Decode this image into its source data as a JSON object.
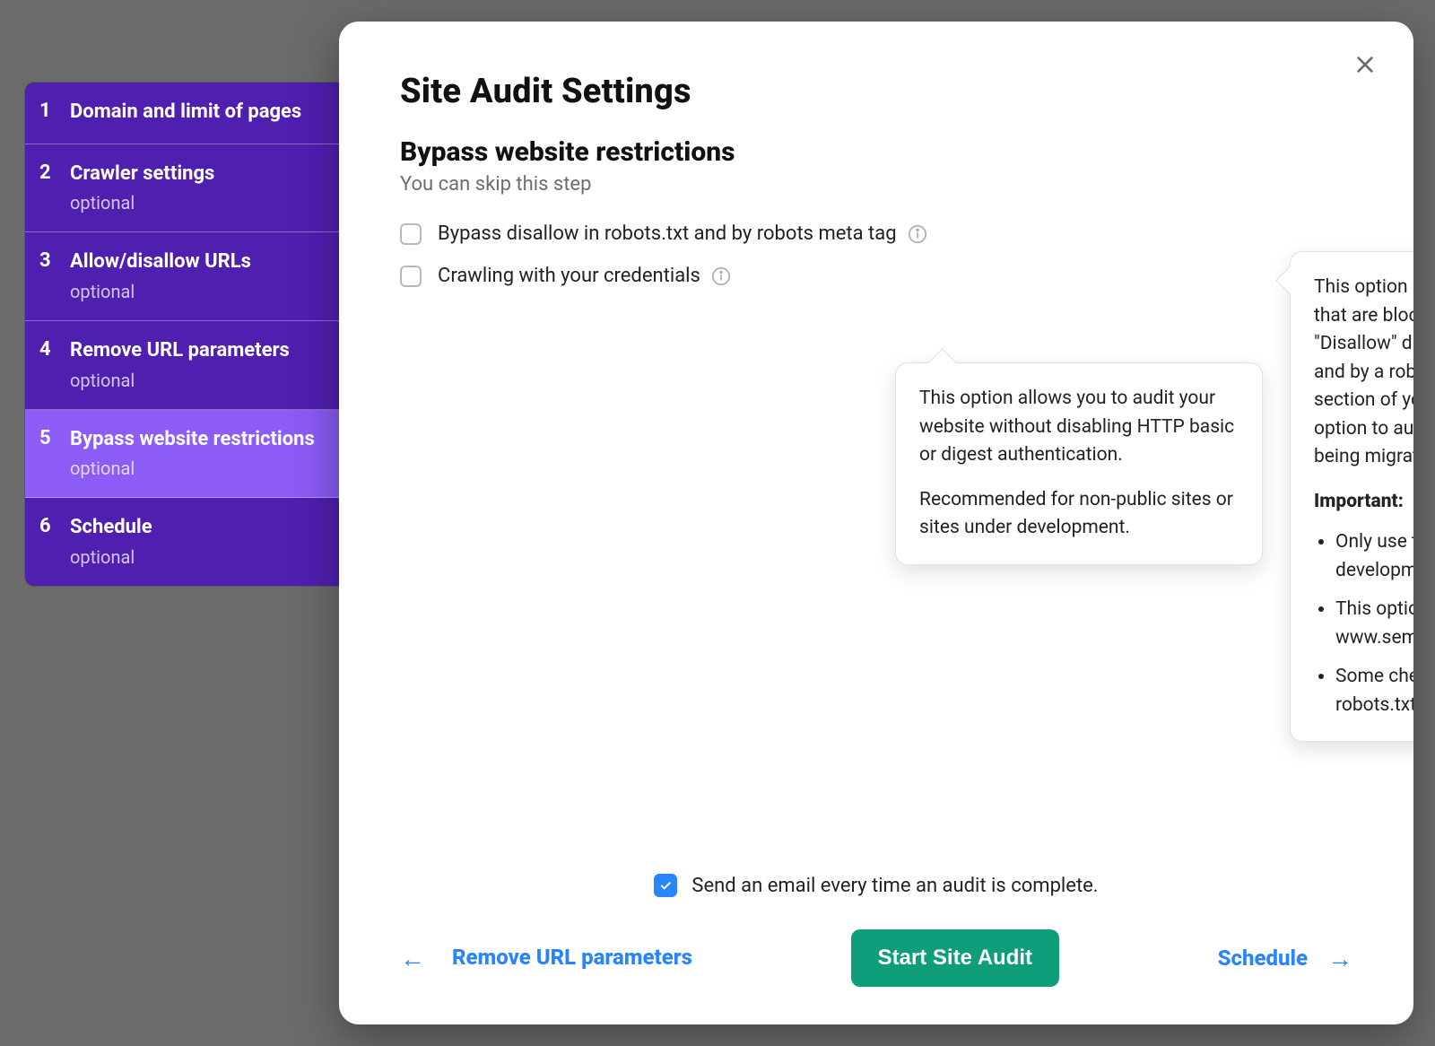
{
  "sidebar": {
    "items": [
      {
        "num": "1",
        "title": "Domain and limit of pages",
        "sub": ""
      },
      {
        "num": "2",
        "title": "Crawler settings",
        "sub": "optional"
      },
      {
        "num": "3",
        "title": "Allow/disallow URLs",
        "sub": "optional"
      },
      {
        "num": "4",
        "title": "Remove URL parameters",
        "sub": "optional"
      },
      {
        "num": "5",
        "title": "Bypass website restrictions",
        "sub": "optional"
      },
      {
        "num": "6",
        "title": "Schedule",
        "sub": "optional"
      }
    ],
    "activeIndex": 4
  },
  "modal": {
    "title": "Site Audit Settings",
    "subTitle": "Bypass website restrictions",
    "subDesc": "You can skip this step",
    "option1": "Bypass disallow in robots.txt and by robots meta tag",
    "option2": "Crawling with your credentials"
  },
  "tipLeft": {
    "p1": "This option allows you to audit your website without disabling HTTP basic or digest authentication.",
    "p2": "Recommended for non-public sites or sites under development."
  },
  "tipRight": {
    "p1": "This option allows you to audit pages that are blocked from crawling by a \"Disallow\" directive in your robots.txt file and by a robots meta tag in the <head> section of your page. You can use this option to audit all pages of the site being migrated.",
    "importantLabel": "Important:",
    "bullets": [
      "Only use this option for sites under development",
      "This option will affect all www.semrush.com subdomains",
      "Some checks regarding your robots.txt may not be triggered"
    ]
  },
  "footer": {
    "emailLabel": "Send an email every time an audit is complete.",
    "backLabel": "Remove URL parameters",
    "primaryLabel": "Start Site Audit",
    "nextLabel": "Schedule"
  }
}
